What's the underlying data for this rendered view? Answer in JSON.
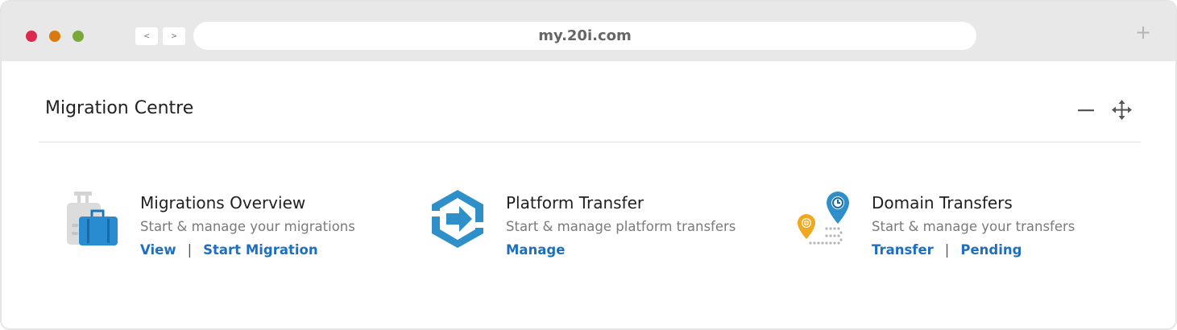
{
  "browser": {
    "url": "my.20i.com",
    "back_label": "<",
    "forward_label": ">",
    "new_tab_label": "+"
  },
  "panel": {
    "title": "Migration Centre"
  },
  "cards": [
    {
      "title": "Migrations Overview",
      "description": "Start & manage your migrations",
      "links": [
        "View",
        "Start Migration"
      ],
      "icon": "luggage-icon"
    },
    {
      "title": "Platform Transfer",
      "description": "Start & manage platform transfers",
      "links": [
        "Manage"
      ],
      "icon": "platform-transfer-icon"
    },
    {
      "title": "Domain Transfers",
      "description": "Start & manage your transfers",
      "links": [
        "Transfer",
        "Pending"
      ],
      "icon": "domain-transfer-icon"
    }
  ],
  "separator": "|",
  "colors": {
    "link": "#1f6fbf",
    "accent_blue": "#2f8fc8",
    "accent_orange": "#f0a81e",
    "traffic_red": "#dc2a4f",
    "traffic_orange": "#d97a0f",
    "traffic_green": "#7aa83a"
  }
}
